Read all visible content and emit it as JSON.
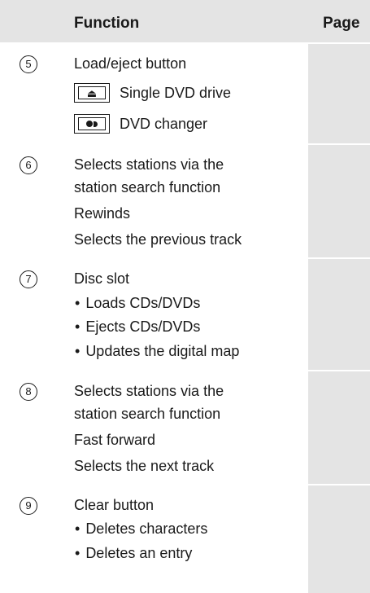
{
  "header": {
    "function": "Function",
    "page": "Page"
  },
  "rows": [
    {
      "number": "5",
      "lines": [
        "Load/eject button",
        "Single DVD drive",
        "DVD changer"
      ]
    },
    {
      "number": "6",
      "lines": [
        "Selects stations via the",
        "station search function",
        "Rewinds",
        "Selects the previous track"
      ]
    },
    {
      "number": "7",
      "lines": [
        "Disc slot",
        "Loads CDs/DVDs",
        "Ejects CDs/DVDs",
        "Updates the digital map"
      ]
    },
    {
      "number": "8",
      "lines": [
        "Selects stations via the",
        "station search function",
        "Fast forward",
        "Selects the next track"
      ]
    },
    {
      "number": "9",
      "lines": [
        "Clear button",
        "Deletes characters",
        "Deletes an entry"
      ]
    }
  ],
  "icons": {
    "eject": "eject-icon",
    "changer": "dvd-changer-icon"
  },
  "colors": {
    "shade": "#e4e4e4",
    "text": "#1a1a1a"
  }
}
